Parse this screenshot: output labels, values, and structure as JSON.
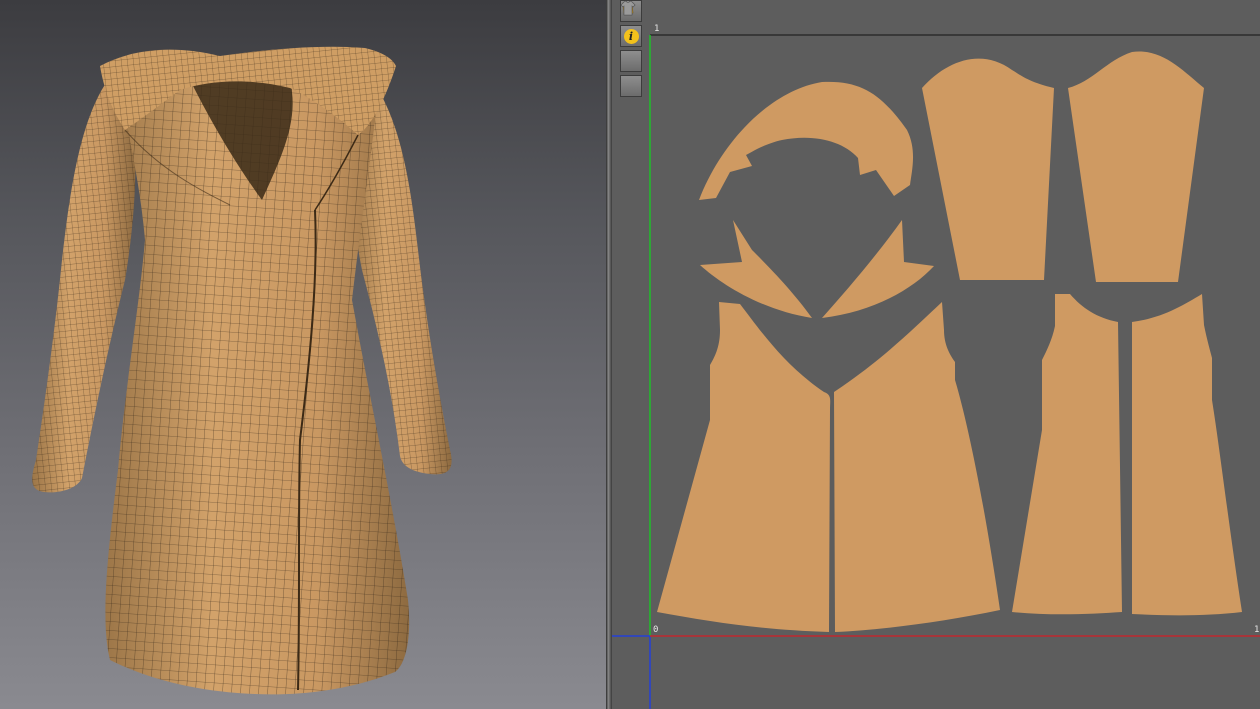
{
  "colors": {
    "fabric": "#cf9a62",
    "fabric_3d": "#c99a5e",
    "mesh_line": "#2c2014",
    "grid_bg": "#5d5d5d",
    "y_axis": "#1fbf2a",
    "x_axis": "#c0282e",
    "blue_axis": "#2440d8",
    "top_line": "#141414"
  },
  "toolbar": {
    "icons": [
      "shirt-view-icon",
      "info-icon",
      "texture-icon",
      "garment-icon"
    ],
    "info_glyph": "i"
  },
  "uv_axes": {
    "origin_label": "0",
    "v_label": "1",
    "u_label": "1"
  },
  "uv_pieces": [
    "collar",
    "left-lapel",
    "right-lapel",
    "left-sleeve-upper",
    "right-sleeve-upper",
    "front-left-panel",
    "front-right-panel",
    "back-left-panel",
    "back-right-panel"
  ]
}
